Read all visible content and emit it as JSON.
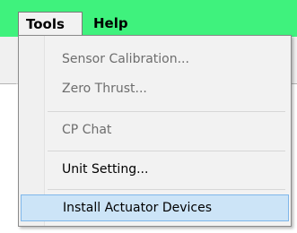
{
  "menubar": {
    "items": [
      {
        "label": "Tools"
      },
      {
        "label": "Help"
      }
    ]
  },
  "tools_menu": {
    "items": [
      {
        "label": "Sensor Calibration...",
        "state": "disabled"
      },
      {
        "label": "Zero Thrust...",
        "state": "disabled"
      },
      {
        "label": "CP Chat",
        "state": "disabled"
      },
      {
        "label": "Unit Setting...",
        "state": "enabled"
      },
      {
        "label": "Install Actuator Devices",
        "state": "highlighted"
      }
    ]
  },
  "colors": {
    "menubar_bg": "#3ff27d",
    "menu_bg": "#f2f2f2",
    "highlight_bg": "#cce4f7",
    "highlight_border": "#7fb7ea",
    "disabled_text": "#6d6d6d"
  }
}
